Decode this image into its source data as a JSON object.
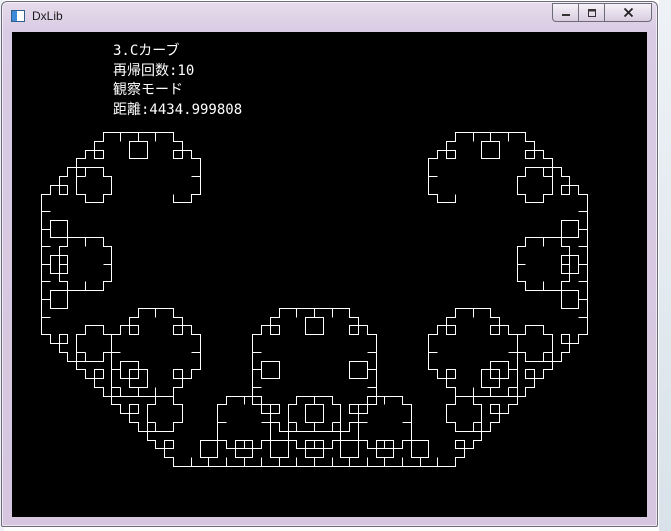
{
  "window": {
    "title": "DxLib",
    "icon": "dxlib-app-icon",
    "controls": {
      "minimize": "minimize-icon",
      "maximize": "maximize-icon",
      "close": "close-icon"
    }
  },
  "overlay": {
    "lines": [
      "3.Cカーブ",
      "再帰回数:10",
      "観察モード",
      "距離:4434.999808"
    ]
  },
  "curve": {
    "name": "C curve (Lévy C curve)",
    "recursion_depth": 10,
    "color": "#ffffff",
    "background": "#000000"
  }
}
